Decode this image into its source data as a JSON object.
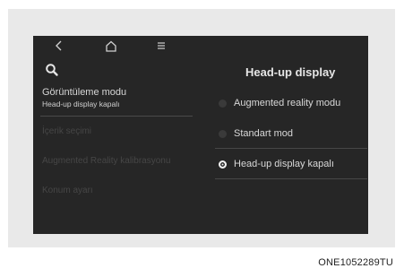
{
  "screen": {
    "title": "Head-up display",
    "nav": {
      "back_icon": "back-arrow-icon",
      "home_icon": "home-icon",
      "menu_icon": "menu-icon"
    },
    "search_icon": "search-icon"
  },
  "left_panel": {
    "mode_item": {
      "label": "Görüntüleme modu",
      "value": "Head-up display kapalı"
    },
    "items": [
      {
        "label": "İçerik seçimi"
      },
      {
        "label": "Augmented Reality kalibrasyonu"
      },
      {
        "label": "Konum ayarı"
      }
    ]
  },
  "options": [
    {
      "label": "Augmented reality modu",
      "selected": false
    },
    {
      "label": "Standart mod",
      "selected": false
    },
    {
      "label": "Head-up display kapalı",
      "selected": true
    }
  ],
  "colors": {
    "screen_bg": "#262626",
    "text": "#d9d9d9",
    "disabled_text": "#464646",
    "frame_bg": "#e9e9e9"
  },
  "caption": "ONE1052289TU"
}
